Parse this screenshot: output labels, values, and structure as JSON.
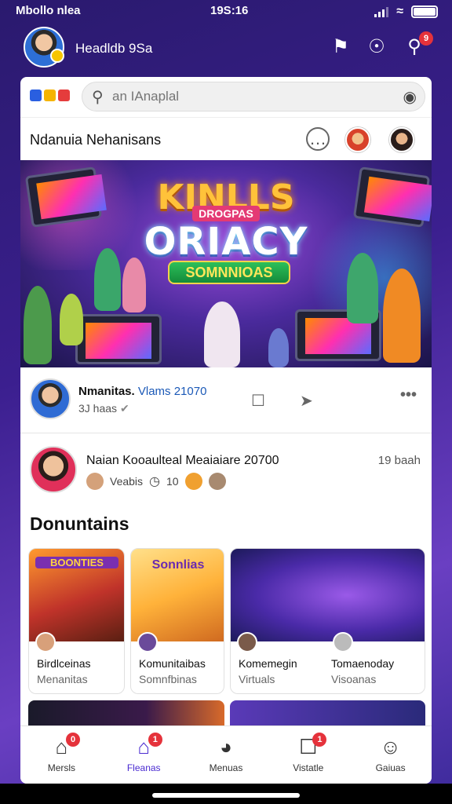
{
  "status_bar": {
    "left_text": "Mbollo nlea",
    "time": "19S:16"
  },
  "top_bar": {
    "username": "Headldb 9Sa",
    "notification_count": "9"
  },
  "search": {
    "placeholder": "an IAnaplal"
  },
  "feed_header": {
    "title": "Ndanuia Nehanisans"
  },
  "banner": {
    "title_top": "KINLLS",
    "subtitle": "DROGPAS",
    "title_main": "ORIACY",
    "badge": "SOMNNIOAS"
  },
  "post1": {
    "name": "Nmanitas.",
    "name_suffix": "Vlams 21070",
    "meta": "3J haas"
  },
  "post2": {
    "name": "Naian Kooaulteal Meaiaiare 20700",
    "time": "19 baah",
    "meta1": "Veabis",
    "meta2": "10"
  },
  "section": {
    "title": "Donuntains"
  },
  "tiles": [
    {
      "title": "Birdlceinas",
      "subtitle": "Menanitas",
      "banner_text": "BOONTIES"
    },
    {
      "title": "Komunitaibas",
      "subtitle": "Somnfbinas",
      "banner_text": "Sonnlias"
    },
    {
      "title": "Komemegin",
      "subtitle": "Virtuals"
    },
    {
      "title": "Tomaenoday",
      "subtitle": "Visoanas"
    }
  ],
  "bottom_nav": [
    {
      "label": "Mersls",
      "badge": "0",
      "icon": "home-icon"
    },
    {
      "label": "Fleanas",
      "badge": "1",
      "icon": "house-icon"
    },
    {
      "label": "Menuas",
      "badge": "",
      "icon": "game-icon"
    },
    {
      "label": "Vistatle",
      "badge": "1",
      "icon": "chat-icon"
    },
    {
      "label": "Gaiuas",
      "badge": "",
      "icon": "profile-icon"
    }
  ],
  "colors": {
    "accent": "#4a2bd1",
    "badge": "#e5323b",
    "link": "#1b59b7"
  }
}
